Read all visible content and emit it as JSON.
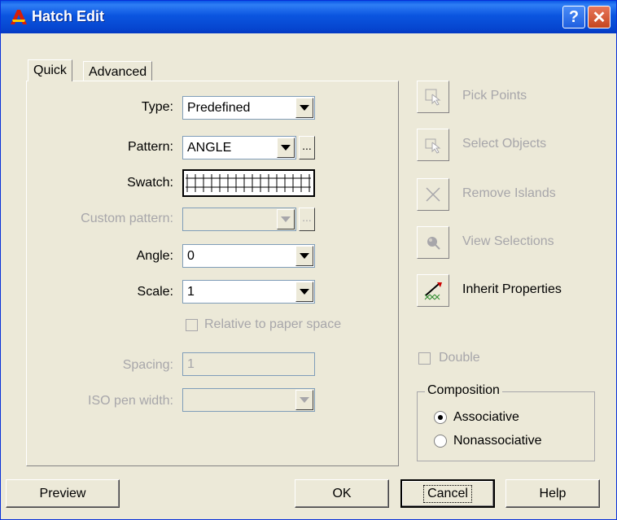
{
  "window": {
    "title": "Hatch Edit",
    "help_label": "?",
    "close_label": "✕"
  },
  "tabs": [
    {
      "label": "Quick"
    },
    {
      "label": "Advanced"
    }
  ],
  "quick": {
    "type_label": "Type:",
    "type_value": "Predefined",
    "pattern_label": "Pattern:",
    "pattern_value": "ANGLE",
    "swatch_label": "Swatch:",
    "custom_pattern_label": "Custom pattern:",
    "custom_pattern_value": "",
    "angle_label": "Angle:",
    "angle_value": "0",
    "scale_label": "Scale:",
    "scale_value": "1",
    "relative_label": "Relative to paper space",
    "spacing_label": "Spacing:",
    "spacing_value": "1",
    "iso_label": "ISO pen width:",
    "iso_value": "",
    "ellipsis": "..."
  },
  "right_buttons": [
    {
      "label": "Pick Points",
      "icon": "pick-points-icon",
      "enabled": false
    },
    {
      "label": "Select Objects",
      "icon": "select-objects-icon",
      "enabled": false
    },
    {
      "label": "Remove Islands",
      "icon": "remove-islands-icon",
      "enabled": false
    },
    {
      "label": "View Selections",
      "icon": "view-selections-icon",
      "enabled": false
    },
    {
      "label": "Inherit Properties",
      "icon": "inherit-properties-icon",
      "enabled": true
    }
  ],
  "double_label": "Double",
  "composition": {
    "title": "Composition",
    "associative": "Associative",
    "nonassociative": "Nonassociative",
    "selected": "Associative"
  },
  "buttons": {
    "preview": "Preview",
    "ok": "OK",
    "cancel": "Cancel",
    "help": "Help"
  },
  "colors": {
    "titlebar": "#0a58e6",
    "face": "#ece9d8",
    "disabled_text": "#a7a6aa"
  }
}
